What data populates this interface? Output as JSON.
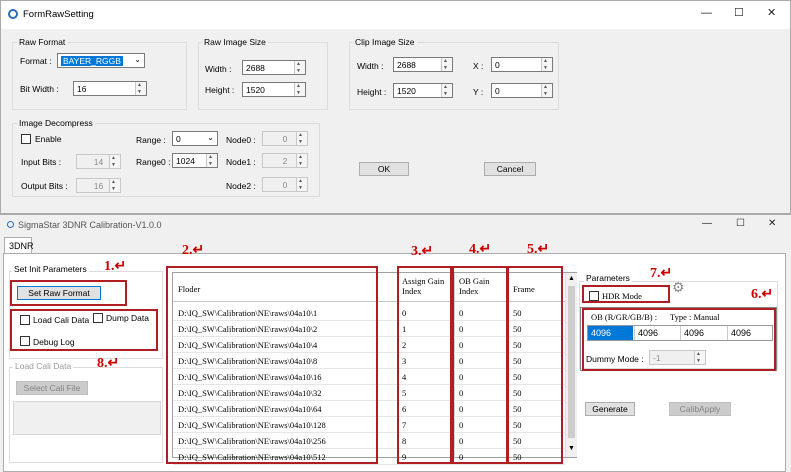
{
  "top_window": {
    "title": "FormRawSetting",
    "controls": [
      "—",
      "☐",
      "✕"
    ],
    "raw_format": {
      "group": "Raw Format",
      "format_label": "Format :",
      "format_value": "BAYER_RGGB",
      "bitwidth_label": "Bit Width :",
      "bitwidth_value": "16"
    },
    "raw_image_size": {
      "group": "Raw Image Size",
      "width_label": "Width :",
      "width_value": "2688",
      "height_label": "Height :",
      "height_value": "1520"
    },
    "clip_image_size": {
      "group": "Clip Image Size",
      "width_label": "Width :",
      "width_value": "2688",
      "height_label": "Height :",
      "height_value": "1520",
      "x_label": "X :",
      "x_value": "0",
      "y_label": "Y :",
      "y_value": "0"
    },
    "image_decompress": {
      "group": "Image Decompress",
      "enable_label": "Enable",
      "input_bits_label": "Input Bits :",
      "input_bits_value": "14",
      "output_bits_label": "Output Bits :",
      "output_bits_value": "16",
      "range_label": "Range :",
      "range_value": "0",
      "range0_label": "Range0 :",
      "range0_value": "1024",
      "node0_label": "Node0 :",
      "node0_value": "0",
      "node1_label": "Node1 :",
      "node1_value": "2",
      "node2_label": "Node2 :",
      "node2_value": "0"
    },
    "ok_label": "OK",
    "cancel_label": "Cancel"
  },
  "bottom_window": {
    "title": "SigmaStar 3DNR Calibration-V1.0.0",
    "tab": "3DNR",
    "set_init_params_group": "Set Init Parameters",
    "set_raw_format_label": "Set Raw Format",
    "load_cali_data_label": "Load Cali Data",
    "dump_data_label": "Dump Data",
    "debug_log_label": "Debug Log",
    "load_cali_group": "Load Cali Data",
    "select_cali_file_label": "Select Cali File",
    "table": {
      "columns": [
        "Floder",
        "Assign Gain Index",
        "OB Gain Index",
        "Frame"
      ],
      "col1_line1": "Assign Gain",
      "col1_line2": "Index",
      "col2_line1": "OB Gain",
      "col2_line2": "Index",
      "rows": [
        {
          "folder": "D:\\IQ_SW\\Calibration\\NE\\raws\\04a10\\1",
          "assign": "0",
          "ob": "0",
          "frame": "50"
        },
        {
          "folder": "D:\\IQ_SW\\Calibration\\NE\\raws\\04a10\\2",
          "assign": "1",
          "ob": "0",
          "frame": "50"
        },
        {
          "folder": "D:\\IQ_SW\\Calibration\\NE\\raws\\04a10\\4",
          "assign": "2",
          "ob": "0",
          "frame": "50"
        },
        {
          "folder": "D:\\IQ_SW\\Calibration\\NE\\raws\\04a10\\8",
          "assign": "3",
          "ob": "0",
          "frame": "50"
        },
        {
          "folder": "D:\\IQ_SW\\Calibration\\NE\\raws\\04a10\\16",
          "assign": "4",
          "ob": "0",
          "frame": "50"
        },
        {
          "folder": "D:\\IQ_SW\\Calibration\\NE\\raws\\04a10\\32",
          "assign": "5",
          "ob": "0",
          "frame": "50"
        },
        {
          "folder": "D:\\IQ_SW\\Calibration\\NE\\raws\\04a10\\64",
          "assign": "6",
          "ob": "0",
          "frame": "50"
        },
        {
          "folder": "D:\\IQ_SW\\Calibration\\NE\\raws\\04a10\\128",
          "assign": "7",
          "ob": "0",
          "frame": "50"
        },
        {
          "folder": "D:\\IQ_SW\\Calibration\\NE\\raws\\04a10\\256",
          "assign": "8",
          "ob": "0",
          "frame": "50"
        },
        {
          "folder": "D:\\IQ_SW\\Calibration\\NE\\raws\\04a10\\512",
          "assign": "9",
          "ob": "0",
          "frame": "50"
        }
      ]
    },
    "parameters_group": "Parameters",
    "hdr_mode_label": "HDR Mode",
    "ob_label": "OB (R/GR/GB/B) :",
    "type_label": "Type : Manual",
    "ob_values": [
      "4096",
      "4096",
      "4096",
      "4096"
    ],
    "dummy_mode_label": "Dummy Mode :",
    "dummy_mode_value": "-1",
    "generate_label": "Generate",
    "calib_apply_label": "CalibApply"
  },
  "annotations": {
    "n1": "1.↵",
    "n2": "2.↵",
    "n3": "3.↵",
    "n4": "4.↵",
    "n5": "5.↵",
    "n6": "6.↵",
    "n7": "7.↵",
    "n8": "8.↵"
  },
  "colors": {
    "highlight": "#0078d7",
    "annotation_red": "#b01e23"
  }
}
